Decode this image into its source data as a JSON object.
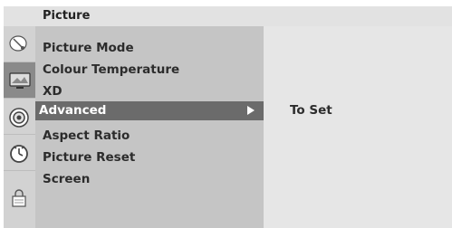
{
  "menu": {
    "title": "Picture",
    "items": [
      {
        "label": "Picture Mode"
      },
      {
        "label": "Colour Temperature"
      },
      {
        "label": "XD"
      },
      {
        "label": "Advanced"
      },
      {
        "label": "Aspect Ratio"
      },
      {
        "label": "Picture Reset"
      },
      {
        "label": "Screen"
      }
    ],
    "selected_item": "Advanced"
  },
  "submenu": {
    "action_label": "To Set"
  },
  "side_icons": [
    "satellite-dish-icon",
    "tv-screen-icon",
    "speaker-icon",
    "clock-icon",
    "lock-icon"
  ]
}
